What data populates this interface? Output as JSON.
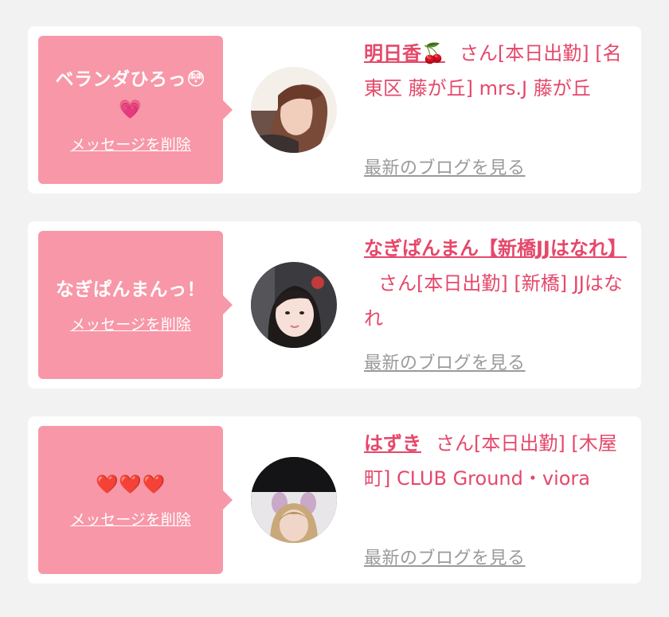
{
  "messages": [
    {
      "message_text": "ベランダひろっ😳💗",
      "delete_label": "メッセージを削除",
      "name": "明日香🍒",
      "suffix": "さん",
      "status": "[本日出勤]",
      "location": "[名東区 藤が丘] mrs.J 藤が丘",
      "blog_label": "最新のブログを見る",
      "avatar_icon": "woman-photo-avatar"
    },
    {
      "message_text": "なぎぱんまんっ！",
      "delete_label": "メッセージを削除",
      "name": "なぎぱんまん【新橋JJはなれ】",
      "suffix": "さん",
      "status": "[本日出勤]",
      "location": "[新橋] JJはなれ",
      "blog_label": "最新のブログを見る",
      "avatar_icon": "woman-photo-avatar"
    },
    {
      "message_text": "❤️❤️❤️",
      "delete_label": "メッセージを削除",
      "name": "はずき",
      "suffix": "さん",
      "status": "[本日出勤]",
      "location": "[木屋町] CLUB Ground・viora",
      "blog_label": "最新のブログを見る",
      "avatar_icon": "woman-photo-avatar"
    }
  ],
  "colors": {
    "page_background": "#f2f2f3",
    "card_background": "#ffffff",
    "bubble_pink": "#f797a8",
    "accent_pink": "#e5486a",
    "link_gray": "#9a9a9a"
  }
}
